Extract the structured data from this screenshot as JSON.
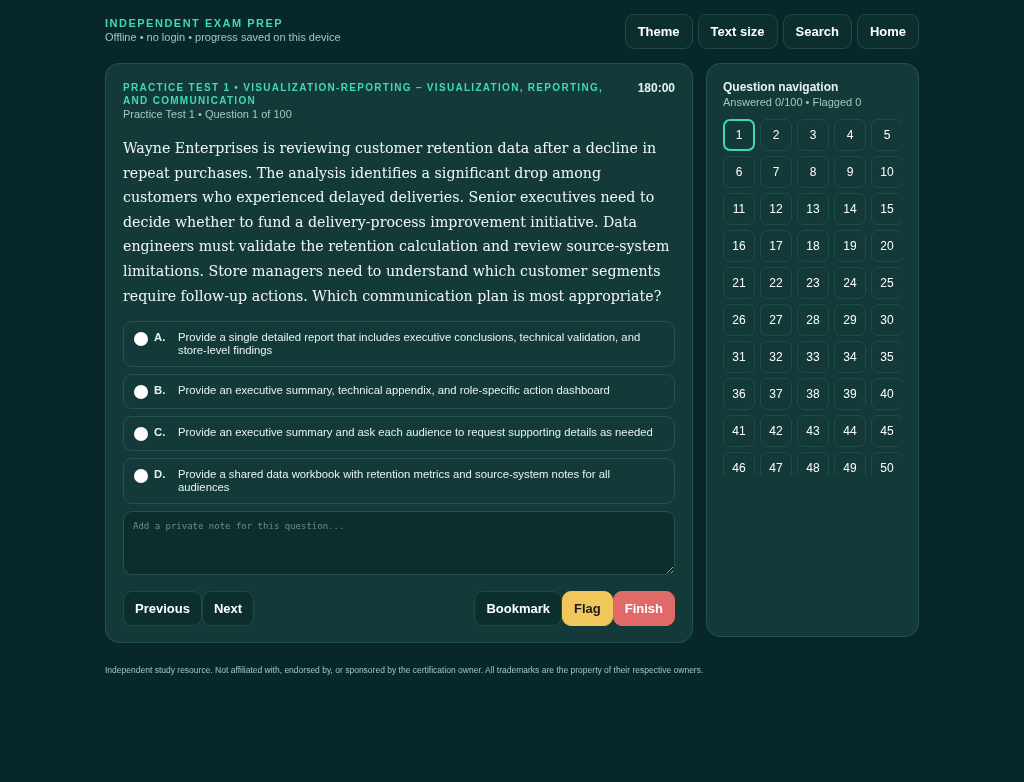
{
  "header": {
    "brand": "INDEPENDENT EXAM PREP",
    "subtitle": "Offline • no login • progress saved on this device",
    "buttons": [
      "Theme",
      "Text size",
      "Search",
      "Home"
    ]
  },
  "question": {
    "heading": "PRACTICE TEST 1 • VISUALIZATION-REPORTING – VISUALIZATION, REPORTING, AND COMMUNICATION",
    "subheading": "Practice Test 1 • Question 1 of 100",
    "timer": "180:00",
    "text": "Wayne Enterprises is reviewing customer retention data after a decline in repeat purchases. The analysis identifies a significant drop among customers who experienced delayed deliveries. Senior executives need to decide whether to fund a delivery-process improvement initiative. Data engineers must validate the retention calculation and review source-system limitations. Store managers need to understand which customer segments require follow-up actions. Which communication plan is most appropriate?",
    "options": [
      {
        "letter": "A.",
        "text": "Provide a single detailed report that includes executive conclusions, technical validation, and store-level findings",
        "selected": false
      },
      {
        "letter": "B.",
        "text": "Provide an executive summary, technical appendix, and role-specific action dashboard",
        "selected": false
      },
      {
        "letter": "C.",
        "text": "Provide an executive summary and ask each audience to request supporting details as needed",
        "selected": false
      },
      {
        "letter": "D.",
        "text": "Provide a shared data workbook with retention metrics and source-system notes for all audiences",
        "selected": false
      }
    ],
    "note": {
      "placeholder": "Add a private note for this question..."
    },
    "buttons": [
      {
        "label": "Previous",
        "kind": "plain"
      },
      {
        "label": "Next",
        "kind": "plain"
      },
      {
        "label": "Bookmark",
        "kind": "plain"
      },
      {
        "label": "Flag",
        "kind": "warning"
      },
      {
        "label": "Finish",
        "kind": "danger"
      }
    ]
  },
  "navigation": {
    "title": "Question navigation",
    "summary": "Answered 0/100 • Flagged 0",
    "questions": [
      {
        "label": "1",
        "selected": true
      },
      {
        "label": "2",
        "selected": false
      },
      {
        "label": "3",
        "selected": false
      },
      {
        "label": "4",
        "selected": false
      },
      {
        "label": "5",
        "selected": false
      },
      {
        "label": "6",
        "selected": false
      },
      {
        "label": "7",
        "selected": false
      },
      {
        "label": "8",
        "selected": false
      },
      {
        "label": "9",
        "selected": false
      },
      {
        "label": "10",
        "selected": false
      },
      {
        "label": "11",
        "selected": false
      },
      {
        "label": "12",
        "selected": false
      },
      {
        "label": "13",
        "selected": false
      },
      {
        "label": "14",
        "selected": false
      },
      {
        "label": "15",
        "selected": false
      },
      {
        "label": "16",
        "selected": false
      },
      {
        "label": "17",
        "selected": false
      },
      {
        "label": "18",
        "selected": false
      },
      {
        "label": "19",
        "selected": false
      },
      {
        "label": "20",
        "selected": false
      },
      {
        "label": "21",
        "selected": false
      },
      {
        "label": "22",
        "selected": false
      },
      {
        "label": "23",
        "selected": false
      },
      {
        "label": "24",
        "selected": false
      },
      {
        "label": "25",
        "selected": false
      },
      {
        "label": "26",
        "selected": false
      },
      {
        "label": "27",
        "selected": false
      },
      {
        "label": "28",
        "selected": false
      },
      {
        "label": "29",
        "selected": false
      },
      {
        "label": "30",
        "selected": false
      },
      {
        "label": "31",
        "selected": false
      },
      {
        "label": "32",
        "selected": false
      },
      {
        "label": "33",
        "selected": false
      },
      {
        "label": "34",
        "selected": false
      },
      {
        "label": "35",
        "selected": false
      },
      {
        "label": "36",
        "selected": false
      },
      {
        "label": "37",
        "selected": false
      },
      {
        "label": "38",
        "selected": false
      },
      {
        "label": "39",
        "selected": false
      },
      {
        "label": "40",
        "selected": false
      },
      {
        "label": "41",
        "selected": false
      },
      {
        "label": "42",
        "selected": false
      },
      {
        "label": "43",
        "selected": false
      },
      {
        "label": "44",
        "selected": false
      },
      {
        "label": "45",
        "selected": false
      },
      {
        "label": "46",
        "selected": false
      },
      {
        "label": "47",
        "selected": false
      },
      {
        "label": "48",
        "selected": false
      },
      {
        "label": "49",
        "selected": false
      },
      {
        "label": "50",
        "selected": false
      }
    ]
  },
  "footer": "Independent study resource. Not affiliated with, endorsed by, or sponsored by the certification owner. All trademarks are the property of their respective owners."
}
